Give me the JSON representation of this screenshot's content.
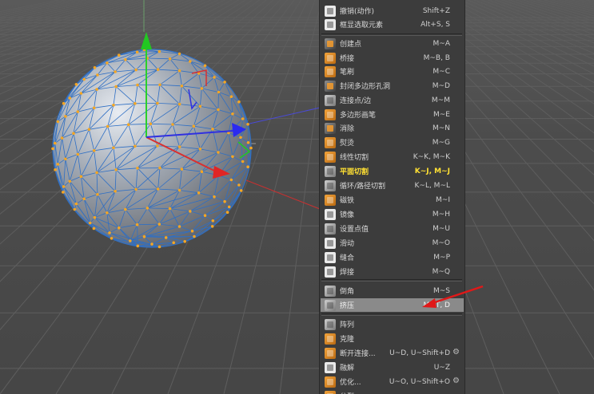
{
  "colors": {
    "viewport_bg": "#4a4a4a",
    "menu_bg": "#3c3c3c",
    "active_text": "#ffe033",
    "highlight_bg": "#8a8a8a",
    "vertex": "#f5a623",
    "wire": "#3a78c8",
    "arrow": "#e02020"
  },
  "menu": {
    "items": [
      {
        "label": "撤销(动作)",
        "shortcut": "Shift+Z",
        "icon": "undo-icon"
      },
      {
        "label": "框显选取元素",
        "shortcut": "Alt+S, S",
        "icon": "frame-selection-icon"
      },
      {
        "label": "创建点",
        "shortcut": "M~A",
        "icon": "create-point-icon"
      },
      {
        "label": "桥接",
        "shortcut": "M~B, B",
        "icon": "bridge-icon"
      },
      {
        "label": "笔刷",
        "shortcut": "M~C",
        "icon": "brush-icon"
      },
      {
        "label": "封闭多边形孔洞",
        "shortcut": "M~D",
        "icon": "close-hole-icon"
      },
      {
        "label": "连接点/边",
        "shortcut": "M~M",
        "icon": "connect-icon"
      },
      {
        "label": "多边形画笔",
        "shortcut": "M~E",
        "icon": "polygon-pen-icon"
      },
      {
        "label": "消除",
        "shortcut": "M~N",
        "icon": "dissolve-icon"
      },
      {
        "label": "熨烫",
        "shortcut": "M~G",
        "icon": "iron-icon"
      },
      {
        "label": "线性切割",
        "shortcut": "K~K, M~K",
        "icon": "knife-icon"
      },
      {
        "label": "平面切割",
        "shortcut": "K~J, M~J",
        "icon": "plane-cut-icon"
      },
      {
        "label": "循环/路径切割",
        "shortcut": "K~L, M~L",
        "icon": "loop-cut-icon"
      },
      {
        "label": "磁铁",
        "shortcut": "M~I",
        "icon": "magnet-icon"
      },
      {
        "label": "镜像",
        "shortcut": "M~H",
        "icon": "mirror-icon"
      },
      {
        "label": "设置点值",
        "shortcut": "M~U",
        "icon": "set-value-icon"
      },
      {
        "label": "滑动",
        "shortcut": "M~O",
        "icon": "slide-icon"
      },
      {
        "label": "缝合",
        "shortcut": "M~P",
        "icon": "stitch-icon"
      },
      {
        "label": "焊接",
        "shortcut": "M~Q",
        "icon": "weld-icon"
      },
      {
        "label": "倒角",
        "shortcut": "M~S",
        "icon": "bevel-icon"
      },
      {
        "label": "挤压",
        "shortcut": "M~T, D",
        "icon": "extrude-icon"
      },
      {
        "label": "阵列",
        "shortcut": "",
        "icon": "array-icon"
      },
      {
        "label": "克隆",
        "shortcut": "",
        "icon": "clone-icon"
      },
      {
        "label": "断开连接...",
        "shortcut": "U~D, U~Shift+D",
        "icon": "disconnect-icon"
      },
      {
        "label": "融解",
        "shortcut": "U~Z",
        "icon": "melt-icon"
      },
      {
        "label": "优化...",
        "shortcut": "U~O, U~Shift+O",
        "icon": "optimize-icon"
      },
      {
        "label": "分裂",
        "shortcut": "",
        "icon": "split-icon"
      }
    ]
  }
}
